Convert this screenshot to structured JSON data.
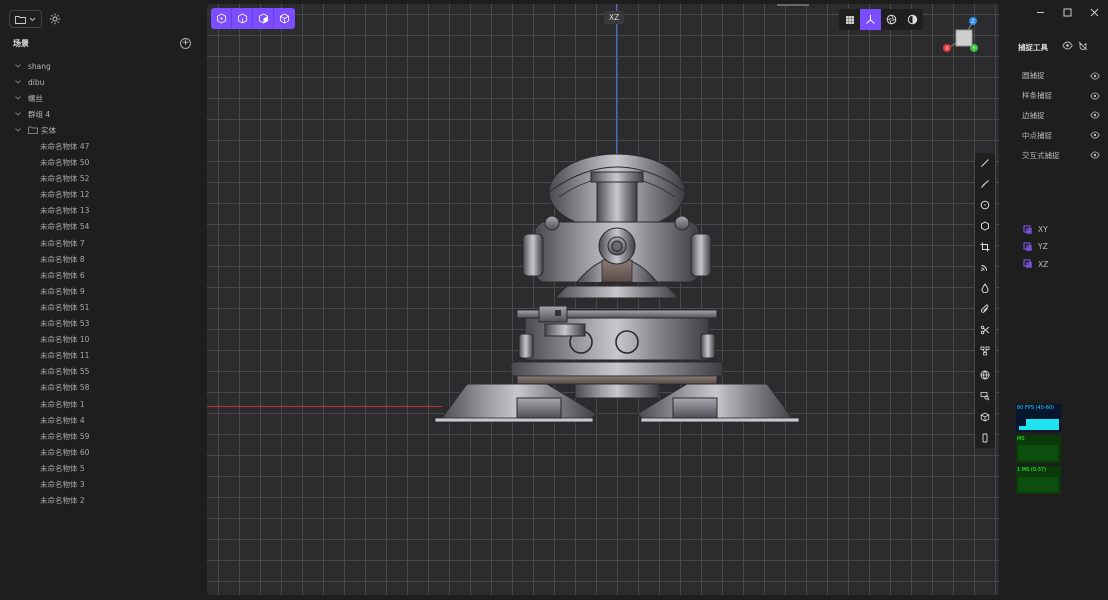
{
  "scene": {
    "title": "场景",
    "groups": [
      {
        "label": "shang"
      },
      {
        "label": "dibu"
      },
      {
        "label": "螺丝"
      },
      {
        "label": "群组 4"
      },
      {
        "label": "实体"
      }
    ],
    "leaves": [
      "未命名物体 47",
      "未命名物体 50",
      "未命名物体 52",
      "未命名物体 12",
      "未命名物体 13",
      "未命名物体 54",
      "未命名物体 7",
      "未命名物体 8",
      "未命名物体 6",
      "未命名物体 9",
      "未命名物体 51",
      "未命名物体 53",
      "未命名物体 10",
      "未命名物体 11",
      "未命名物体 55",
      "未命名物体 58",
      "未命名物体 1",
      "未命名物体 4",
      "未命名物体 59",
      "未命名物体 60",
      "未命名物体 5",
      "未命名物体 3",
      "未命名物体 2"
    ]
  },
  "viewport": {
    "view_label": "XZ",
    "gizmo": {
      "x": "X",
      "y": "Y",
      "z": "Z"
    }
  },
  "snap": {
    "title": "捕捉工具",
    "items": [
      "圆捕捉",
      "样条捕捉",
      "边捕捉",
      "中点捕捉",
      "交互式捕捉"
    ]
  },
  "planes": [
    "XY",
    "YZ",
    "XZ"
  ],
  "stats": {
    "fps": "60 FPS (45-60)",
    "ms": "MS",
    "mem": "1 MS (0-37)"
  },
  "colors": {
    "accent": "#7c4dff",
    "axis_x": "#e23b3b",
    "axis_y": "#3fbf3f",
    "axis_z": "#2e8cf0"
  }
}
